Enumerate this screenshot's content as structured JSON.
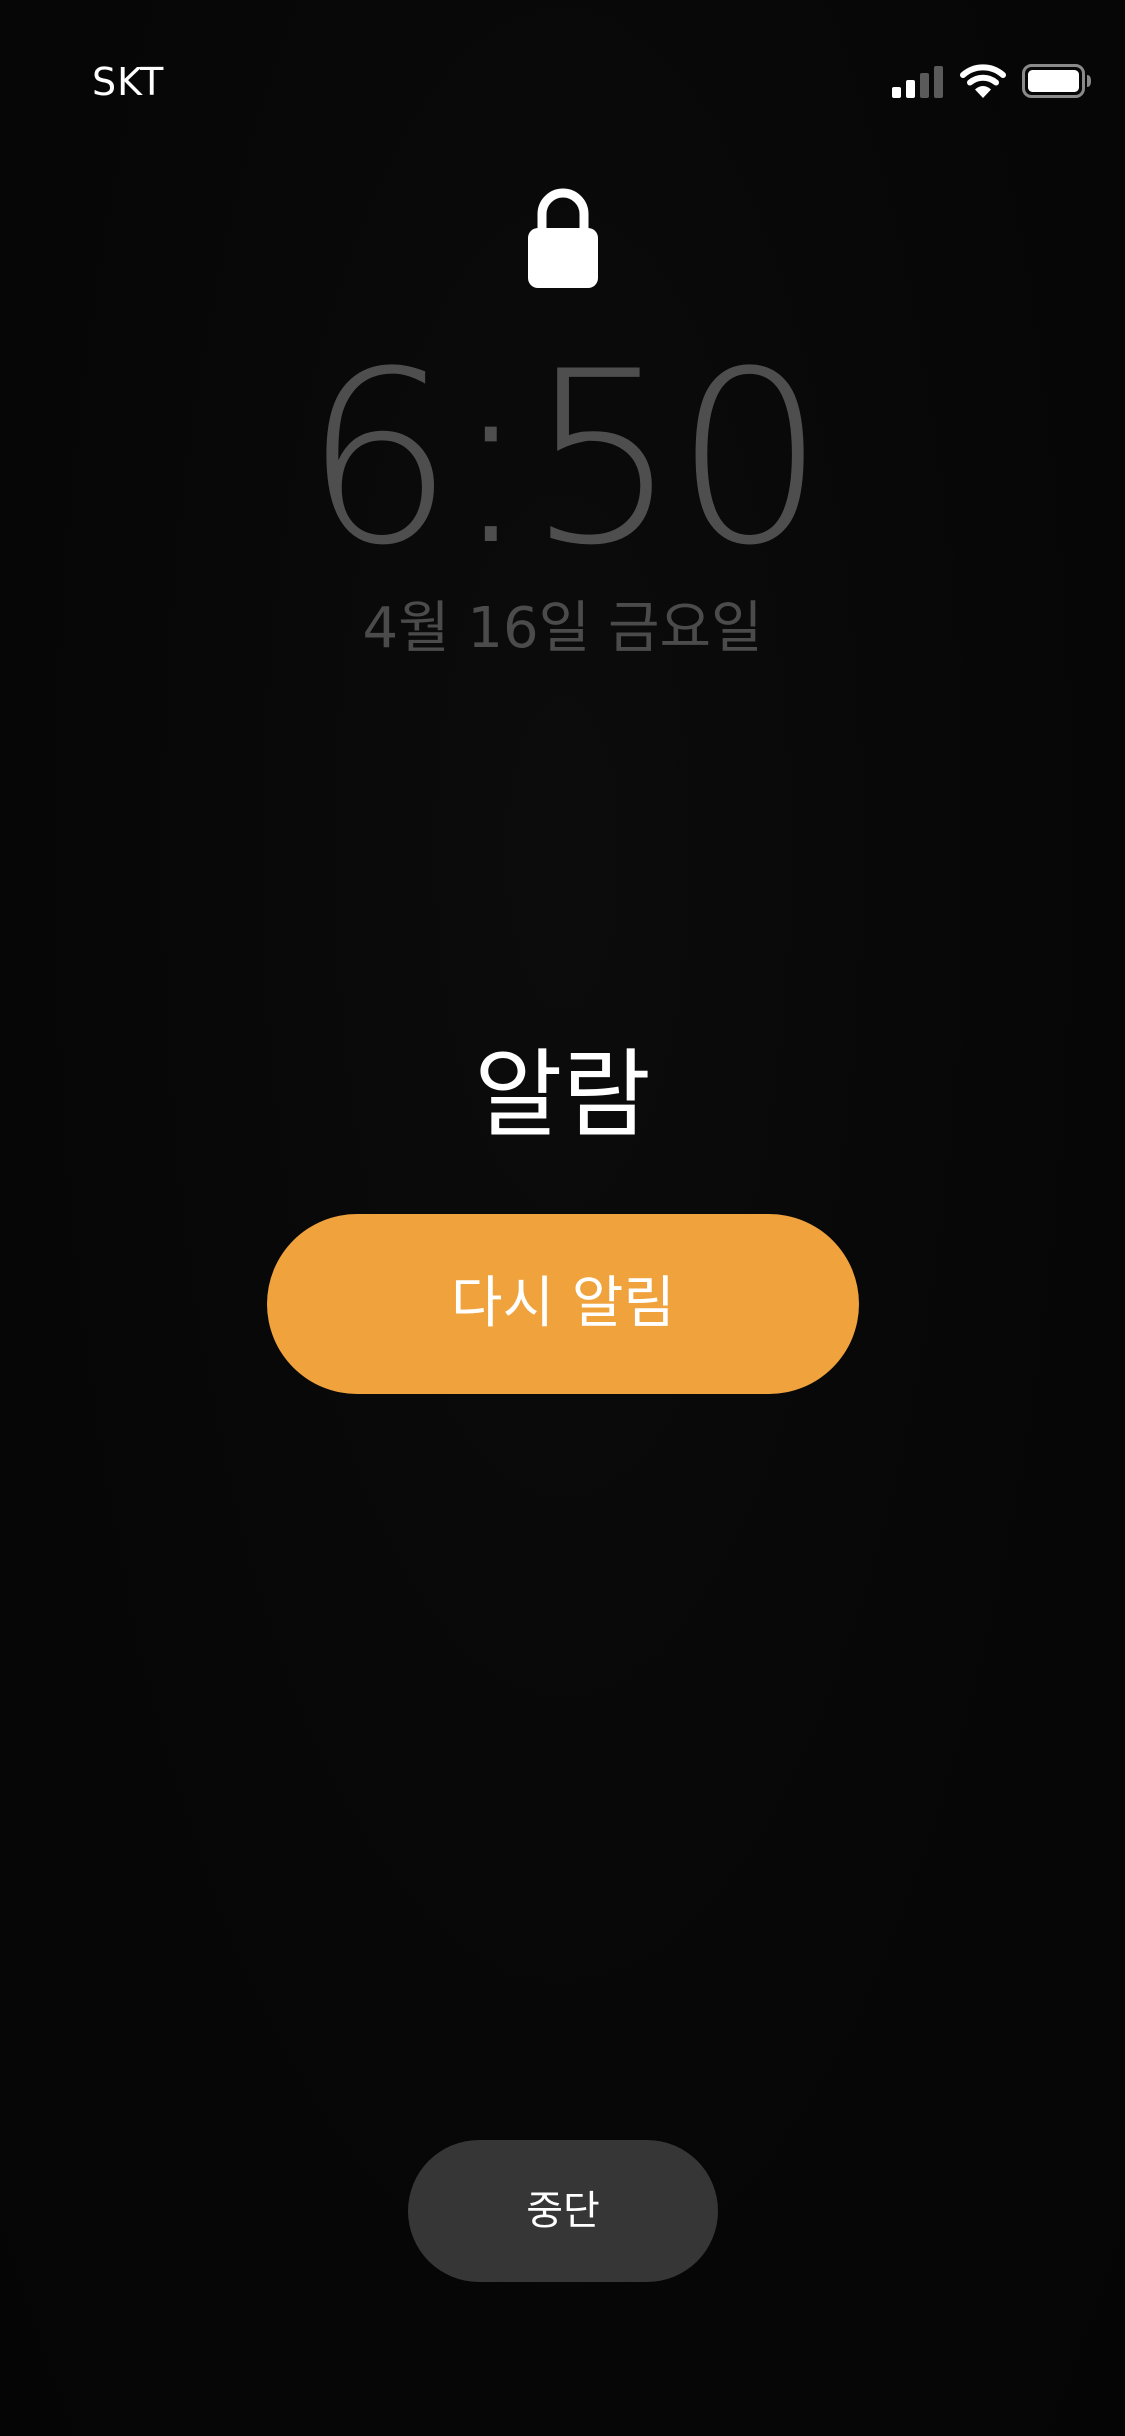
{
  "status_bar": {
    "carrier": "SKT",
    "signal_bars_filled": 2,
    "signal_bars_total": 4,
    "wifi_icon": "wifi-icon",
    "battery_icon": "battery-icon",
    "battery_level": 1.0
  },
  "lock_icon": "lock-icon",
  "lock_screen": {
    "time": "6:50",
    "date": "4월 16일 금요일"
  },
  "alarm": {
    "label": "알람",
    "snooze_label": "다시 알림",
    "stop_label": "중단"
  },
  "colors": {
    "background": "#060606",
    "snooze_accent": "#f0a33d",
    "stop_button_bg": "#363636",
    "time_text": "#4e4e4e",
    "date_text": "#4b4b4b"
  }
}
